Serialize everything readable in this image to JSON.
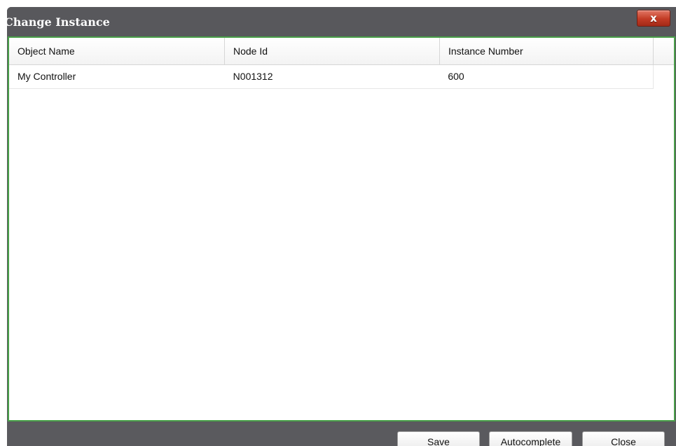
{
  "dialog": {
    "title": "Change Instance",
    "close_glyph": "x"
  },
  "grid": {
    "columns": [
      "Object Name",
      "Node Id",
      "Instance Number"
    ],
    "rows": [
      [
        "My Controller",
        "N001312",
        "600"
      ]
    ]
  },
  "footer": {
    "save_label": "Save",
    "autocomplete_label": "Autocomplete",
    "close_label": "Close"
  },
  "colors": {
    "titlebar": "#58585c",
    "content_border": "#49a049",
    "close_button": "#c23b25"
  },
  "icons": {
    "close": "close-icon"
  }
}
